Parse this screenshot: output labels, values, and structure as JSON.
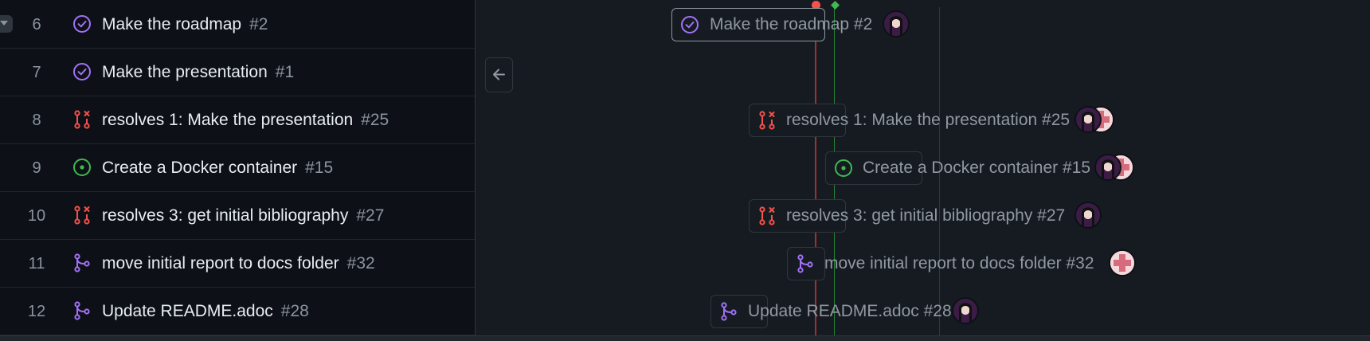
{
  "rows": [
    {
      "number": "6",
      "title": "Make the roadmap",
      "issue": "#2",
      "icon": "issue-closed-icon"
    },
    {
      "number": "7",
      "title": "Make the presentation",
      "issue": "#1",
      "icon": "issue-closed-icon"
    },
    {
      "number": "8",
      "title": "resolves 1: Make the presentation",
      "issue": "#25",
      "icon": "pull-request-closed-icon"
    },
    {
      "number": "9",
      "title": "Create a Docker container",
      "issue": "#15",
      "icon": "issue-open-icon"
    },
    {
      "number": "10",
      "title": "resolves 3: get initial bibliography",
      "issue": "#27",
      "icon": "pull-request-closed-icon"
    },
    {
      "number": "11",
      "title": "move initial report to docs folder",
      "issue": "#32",
      "icon": "pull-request-merged-icon"
    },
    {
      "number": "12",
      "title": "Update README.adoc",
      "issue": "#28",
      "icon": "pull-request-merged-icon"
    }
  ],
  "roadmap_bars": [
    {
      "label": "Make the roadmap #2",
      "assignees": [
        "avatar-user"
      ]
    },
    {
      "label": "resolves 1: Make the presentation #25",
      "assignees": [
        "avatar-user",
        "avatar-user-2"
      ]
    },
    {
      "label": "Create a Docker container #15",
      "assignees": [
        "avatar-user",
        "avatar-user-2"
      ]
    },
    {
      "label": "resolves 3: get initial bibliography #27",
      "assignees": [
        "avatar-user"
      ]
    },
    {
      "label": "move initial report to docs folder #32",
      "assignees": [
        "avatar-user-2"
      ]
    },
    {
      "label": "Update README.adoc #28",
      "assignees": [
        "avatar-user"
      ]
    }
  ],
  "colors": {
    "closed_issue": "#a371f7",
    "open_issue": "#3fb950",
    "closed_pr": "#f85149",
    "merged_pr": "#a371f7",
    "today_marker": "#f85149",
    "iteration_marker": "#3fb950"
  }
}
